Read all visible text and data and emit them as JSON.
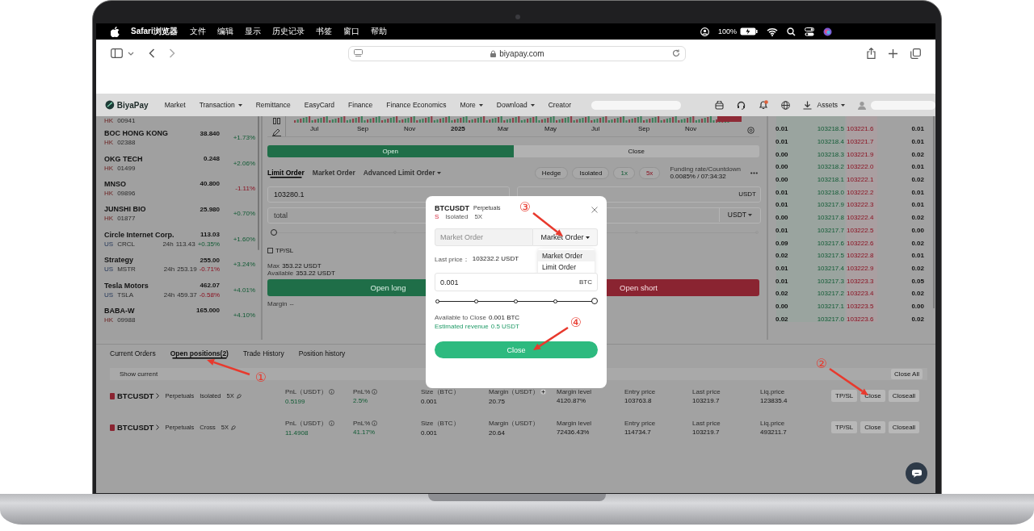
{
  "menu_bar": {
    "app": "Safari浏览器",
    "items": [
      "文件",
      "编辑",
      "显示",
      "历史记录",
      "书签",
      "窗口",
      "帮助"
    ],
    "battery": "100%"
  },
  "browser": {
    "url": "biyapay.com"
  },
  "nav": {
    "logo": "BiyaPay",
    "items": [
      {
        "label": "Market",
        "dropdown": false
      },
      {
        "label": "Transaction",
        "dropdown": true
      },
      {
        "label": "Remittance",
        "dropdown": false
      },
      {
        "label": "EasyCard",
        "dropdown": false
      },
      {
        "label": "Finance",
        "dropdown": false
      },
      {
        "label": "Finance Economics",
        "dropdown": false
      },
      {
        "label": "More",
        "dropdown": true
      },
      {
        "label": "Download",
        "dropdown": true
      },
      {
        "label": "Creator",
        "dropdown": false
      }
    ],
    "unread": true,
    "assets": "Assets"
  },
  "watchlist": [
    {
      "market": "HK",
      "code": "00941"
    },
    {
      "name": "BOC HONG KONG",
      "market": "HK",
      "code": "02388",
      "price": "38.840",
      "change": "+1.73%",
      "kind": "gain"
    },
    {
      "name": "OKG TECH",
      "market": "HK",
      "code": "01499",
      "price": "0.248",
      "change": "+2.06%",
      "kind": "gain"
    },
    {
      "name": "MNSO",
      "market": "HK",
      "code": "09896",
      "price": "40.800",
      "change": "-1.11%",
      "kind": "loss"
    },
    {
      "name": "JUNSHI BIO",
      "market": "HK",
      "code": "01877",
      "price": "25.980",
      "change": "+0.70%",
      "kind": "gain"
    },
    {
      "name": "Circle Internet Corp.",
      "market": "US",
      "code": "CRCL",
      "price": "113.03",
      "extended": {
        "label": "24h",
        "price": "113.43",
        "change": "+0.35%",
        "kind": "gain"
      },
      "change": "+1.60%",
      "kind": "gain"
    },
    {
      "name": "Strategy",
      "market": "US",
      "code": "MSTR",
      "price": "255.00",
      "extended": {
        "label": "24h",
        "price": "253.19",
        "change": "-0.71%",
        "kind": "loss"
      },
      "change": "+3.24%",
      "kind": "gain"
    },
    {
      "name": "Tesla Motors",
      "market": "US",
      "code": "TSLA",
      "price": "462.07",
      "extended": {
        "label": "24h",
        "price": "459.37",
        "change": "-0.58%",
        "kind": "loss"
      },
      "change": "+4.01%",
      "kind": "gain"
    },
    {
      "name": "BABA-W",
      "market": "HK",
      "code": "09988",
      "price": "165.000",
      "change": "+4.10%",
      "kind": "gain"
    }
  ],
  "chart": {
    "axis_labels": [
      "Jul",
      "Sep",
      "Nov",
      "2025",
      "Mar",
      "May",
      "Jul",
      "Sep",
      "Nov"
    ]
  },
  "trade": {
    "sides": [
      {
        "label": "Open",
        "selected": true
      },
      {
        "label": "Close",
        "selected": false
      }
    ],
    "order_types": [
      {
        "label": "Limit Order",
        "selected": true,
        "dropdown": false
      },
      {
        "label": "Market Order",
        "selected": false,
        "dropdown": false
      },
      {
        "label": "Advanced Limit Order",
        "selected": false,
        "dropdown": true
      }
    ],
    "chips": [
      {
        "label": "Hedge",
        "kind": "plain"
      },
      {
        "label": "Isolated",
        "kind": "plain"
      },
      {
        "label": "1x",
        "kind": "long"
      },
      {
        "label": "5x",
        "kind": "short"
      }
    ],
    "funding": {
      "label": "Funding rate/Countdown",
      "value": "0.0085% / 07:34:32"
    },
    "fields": [
      {
        "value": "103280.1"
      },
      {
        "unit": "USDT",
        "dropdown": false
      },
      {
        "placeholder": "total"
      },
      {
        "unit": "USDT",
        "dropdown": true
      }
    ],
    "slider": {
      "level": 0
    },
    "tpsl": {
      "label": "TP/SL",
      "checked": false
    },
    "balances": [
      {
        "label": "Max",
        "value": "353.22 USDT"
      },
      {
        "label": "Available",
        "value": "353.22 USDT"
      }
    ],
    "buttons": [
      {
        "label": "Open long",
        "kind": "long"
      },
      {
        "label": "Open short",
        "kind": "short"
      }
    ],
    "margin": {
      "label": "Margin",
      "value": "--"
    }
  },
  "order_book": [
    [
      "0.01",
      "103218.5",
      "103221.6",
      "0.01"
    ],
    [
      "0.01",
      "103218.4",
      "103221.7",
      "0.01"
    ],
    [
      "0.00",
      "103218.3",
      "103221.9",
      "0.02"
    ],
    [
      "0.00",
      "103218.2",
      "103222.0",
      "0.01"
    ],
    [
      "0.00",
      "103218.1",
      "103222.1",
      "0.02"
    ],
    [
      "0.01",
      "103218.0",
      "103222.2",
      "0.01"
    ],
    [
      "0.01",
      "103217.9",
      "103222.3",
      "0.01"
    ],
    [
      "0.00",
      "103217.8",
      "103222.4",
      "0.02"
    ],
    [
      "0.01",
      "103217.7",
      "103222.5",
      "0.00"
    ],
    [
      "0.09",
      "103217.6",
      "103222.6",
      "0.02"
    ],
    [
      "0.02",
      "103217.5",
      "103222.8",
      "0.01"
    ],
    [
      "0.01",
      "103217.4",
      "103222.9",
      "0.02"
    ],
    [
      "0.01",
      "103217.3",
      "103223.3",
      "0.05"
    ],
    [
      "0.02",
      "103217.2",
      "103223.4",
      "0.02"
    ],
    [
      "0.00",
      "103217.1",
      "103223.5",
      "0.00"
    ],
    [
      "0.02",
      "103217.0",
      "103223.6",
      "0.02"
    ]
  ],
  "positions_tabs": [
    {
      "label": "Current Orders",
      "selected": false
    },
    {
      "label": "Open positions(2)",
      "selected": true
    },
    {
      "label": "Trade History",
      "selected": false
    },
    {
      "label": "Position history",
      "selected": false
    }
  ],
  "show_current": "Show current",
  "close_all": "Close All",
  "positions": [
    {
      "symbol": "BTCUSDT",
      "type": "Perpetuals",
      "mode": "Isolated",
      "leverage": "5X",
      "fields": [
        {
          "label": "PnL（USDT）",
          "value": "0.5199",
          "info": true,
          "kind": "gain"
        },
        {
          "label": "PnL%",
          "value": "2.5%",
          "info": true,
          "kind": "gain"
        },
        {
          "label": "Size（BTC）",
          "value": "0.001"
        },
        {
          "label": "Margin（USDT）",
          "value": "20.75",
          "add": true
        },
        {
          "label": "Margin level",
          "value": "4120.87%"
        },
        {
          "label": "Entry price",
          "value": "103763.8"
        },
        {
          "label": "Last price",
          "value": "103219.7"
        },
        {
          "label": "Liq.price",
          "value": "123835.4"
        }
      ],
      "actions": [
        "TP/SL",
        "Close",
        "Closeall"
      ]
    },
    {
      "symbol": "BTCUSDT",
      "type": "Perpetuals",
      "mode": "Cross",
      "leverage": "5X",
      "fields": [
        {
          "label": "PnL（USDT）",
          "value": "11.4908",
          "info": true,
          "kind": "gain"
        },
        {
          "label": "PnL%",
          "value": "41.17%",
          "info": true,
          "kind": "gain"
        },
        {
          "label": "Size（BTC）",
          "value": "0.001"
        },
        {
          "label": "Margin（USDT）",
          "value": "20.64"
        },
        {
          "label": "Margin level",
          "value": "72436.43%"
        },
        {
          "label": "Entry price",
          "value": "114734.7"
        },
        {
          "label": "Last price",
          "value": "103219.7"
        },
        {
          "label": "Liq.price",
          "value": "493211.7"
        }
      ],
      "actions": [
        "TP/SL",
        "Close",
        "Closeall"
      ]
    }
  ],
  "modal": {
    "symbol": "BTCUSDT",
    "tag": "Perpetuals",
    "side": "S",
    "mode": "Isolated",
    "leverage": "5X",
    "type_placeholder": "Market Order",
    "type_select": "Market Order",
    "options": [
      {
        "label": "Market Order",
        "selected": true
      },
      {
        "label": "Limit Order",
        "selected": false
      }
    ],
    "last_price_label": "Last price：",
    "last_price": "103232.2 USDT",
    "amount": "0.001",
    "amount_unit": "BTC",
    "slider": {
      "level": 1
    },
    "available_label": "Available to Close",
    "available": "0.001 BTC",
    "revenue_label": "Estimated revenue",
    "revenue": "0.5 USDT",
    "button": "Close"
  },
  "annotations": [
    {
      "number": "①"
    },
    {
      "number": "②"
    },
    {
      "number": "③"
    },
    {
      "number": "④"
    }
  ]
}
